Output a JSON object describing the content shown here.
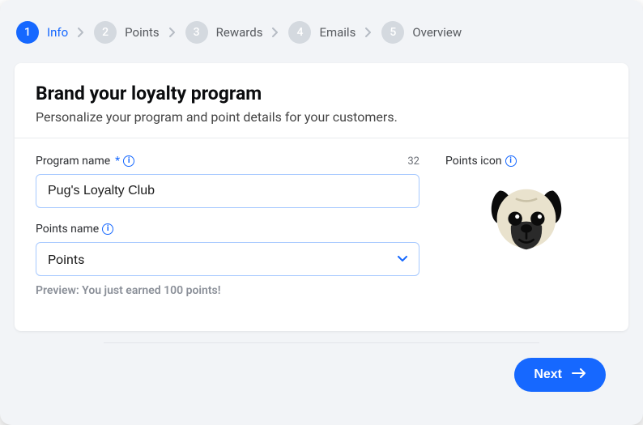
{
  "stepper": {
    "steps": [
      {
        "num": "1",
        "label": "Info",
        "active": true
      },
      {
        "num": "2",
        "label": "Points",
        "active": false
      },
      {
        "num": "3",
        "label": "Rewards",
        "active": false
      },
      {
        "num": "4",
        "label": "Emails",
        "active": false
      },
      {
        "num": "5",
        "label": "Overview",
        "active": false
      }
    ]
  },
  "card": {
    "title": "Brand your loyalty program",
    "subtitle": "Personalize your program and point details for your customers."
  },
  "program_name": {
    "label": "Program name",
    "required_mark": "*",
    "counter": "32",
    "value": "Pug's Loyalty Club"
  },
  "points_name": {
    "label": "Points name",
    "selected": "Points"
  },
  "preview": {
    "label": "Preview:",
    "text": "You just earned 100 points!"
  },
  "points_icon": {
    "label": "Points icon"
  },
  "actions": {
    "next": "Next"
  },
  "info_glyph": "i"
}
